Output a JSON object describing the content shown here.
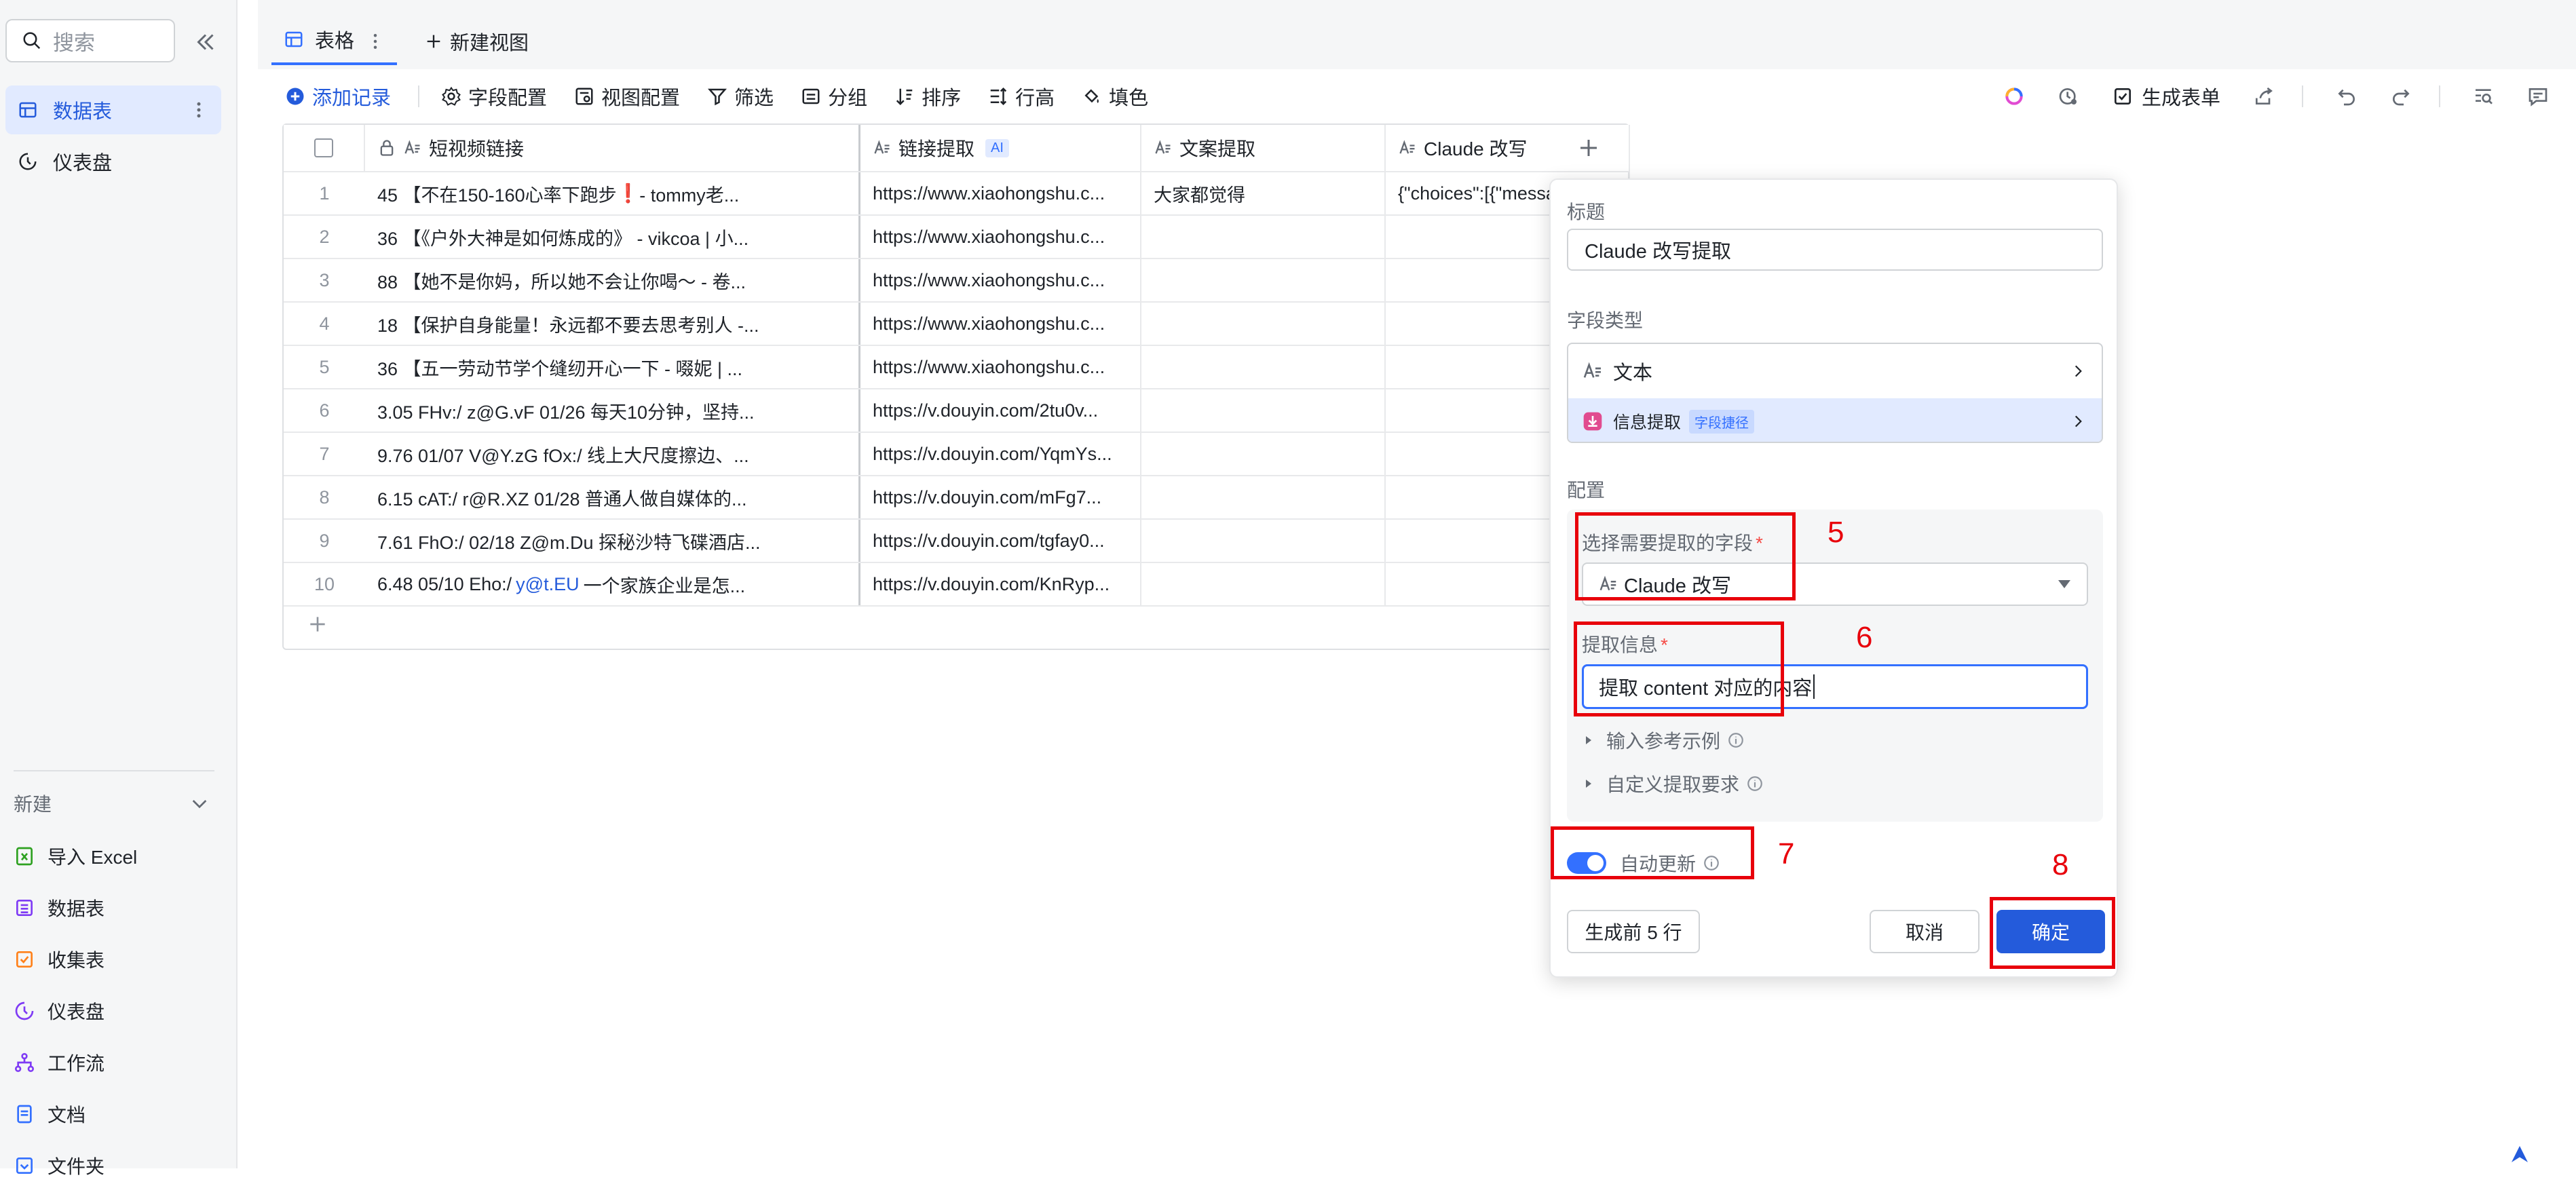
{
  "sidebar": {
    "search_placeholder": "搜索",
    "nav": [
      {
        "label": "数据表",
        "active": true
      },
      {
        "label": "仪表盘",
        "active": false
      }
    ],
    "new_header": "新建",
    "create_items": [
      {
        "label": "导入 Excel",
        "icon": "excel-icon",
        "color": "#2ea121"
      },
      {
        "label": "数据表",
        "icon": "table-icon",
        "color": "#7f3bf5"
      },
      {
        "label": "收集表",
        "icon": "form-icon",
        "color": "#ff811a"
      },
      {
        "label": "仪表盘",
        "icon": "dashboard-icon",
        "color": "#7f3bf5"
      },
      {
        "label": "工作流",
        "icon": "workflow-icon",
        "color": "#7f3bf5"
      },
      {
        "label": "文档",
        "icon": "doc-icon",
        "color": "#3370ff"
      },
      {
        "label": "文件夹",
        "icon": "folder-icon",
        "color": "#3370ff"
      }
    ]
  },
  "tabs": {
    "active": "表格",
    "new_view": "新建视图"
  },
  "toolbar": {
    "add_record": "添加记录",
    "field_config": "字段配置",
    "view_config": "视图配置",
    "filter": "筛选",
    "group": "分组",
    "sort": "排序",
    "row_height": "行高",
    "fill": "填色",
    "generate_form": "生成表单"
  },
  "table": {
    "columns": [
      {
        "label": "短视频链接"
      },
      {
        "label": "链接提取",
        "badge": "AI"
      },
      {
        "label": "文案提取"
      },
      {
        "label": "Claude 改写"
      }
    ],
    "rows": [
      {
        "n": "1",
        "c1": "45 【不在150-160心率下跑步",
        "c1_mark": "❗",
        "c1_tail": " - tommy老...",
        "c2": "https://www.xiaohongshu.c...",
        "c3": "大家都觉得",
        "c4": "{\"choices\":[{\"message..."
      },
      {
        "n": "2",
        "c1": "36 【《户外大神是如何炼成的》 - vikcoa | 小...",
        "c2": "https://www.xiaohongshu.c...",
        "c3": "",
        "c4": ""
      },
      {
        "n": "3",
        "c1": "88 【她不是你妈，所以她不会让你喝～ - 卷...",
        "c2": "https://www.xiaohongshu.c...",
        "c3": "",
        "c4": ""
      },
      {
        "n": "4",
        "c1": "18 【保护自身能量！永远都不要去思考别人 -...",
        "c2": "https://www.xiaohongshu.c...",
        "c3": "",
        "c4": ""
      },
      {
        "n": "5",
        "c1": "36 【五一劳动节学个缝纫开心一下 - 啜妮 | ...",
        "c2": "https://www.xiaohongshu.c...",
        "c3": "",
        "c4": ""
      },
      {
        "n": "6",
        "c1": "3.05 FHv:/ z@G.vF 01/26 每天10分钟，坚持...",
        "c2": "https://v.douyin.com/2tu0v...",
        "c3": "",
        "c4": ""
      },
      {
        "n": "7",
        "c1": "9.76 01/07 V@Y.zG fOx:/ 线上大尺度擦边、...",
        "c2": "https://v.douyin.com/YqmYs...",
        "c3": "",
        "c4": ""
      },
      {
        "n": "8",
        "c1": "6.15 cAT:/ r@R.XZ 01/28 普通人做自媒体的...",
        "c2": "https://v.douyin.com/mFg7...",
        "c3": "",
        "c4": ""
      },
      {
        "n": "9",
        "c1": "7.61 FhO:/ 02/18 Z@m.Du 探秘沙特飞碟酒店...",
        "c2": "https://v.douyin.com/tgfay0...",
        "c3": "",
        "c4": ""
      },
      {
        "n": "10",
        "c1": "6.48 05/10 Eho:/ ",
        "c1_link": "y@t.EU",
        "c1_tail": " 一个家族企业是怎...",
        "c2": "https://v.douyin.com/KnRyp...",
        "c3": "",
        "c4": ""
      }
    ]
  },
  "panel": {
    "title_label": "标题",
    "title_value": "Claude 改写提取",
    "field_type_label": "字段类型",
    "field_type_value": "文本",
    "extract_label": "信息提取",
    "extract_badge": "字段捷径",
    "config_label": "配置",
    "select_field_label": "选择需要提取的字段",
    "select_field_value": "Claude 改写",
    "extract_info_label": "提取信息",
    "extract_info_value": "提取 content 对应的内容",
    "ref_example": "输入参考示例",
    "custom_req": "自定义提取要求",
    "auto_update": "自动更新",
    "gen_button": "生成前 5 行",
    "cancel": "取消",
    "confirm": "确定"
  },
  "annotations": [
    "5",
    "6",
    "7",
    "8"
  ],
  "colors": {
    "accent": "#3370ff",
    "primary_button": "#245bdb",
    "annotation": "#e8000b",
    "active_nav_bg": "#e1eaff"
  }
}
